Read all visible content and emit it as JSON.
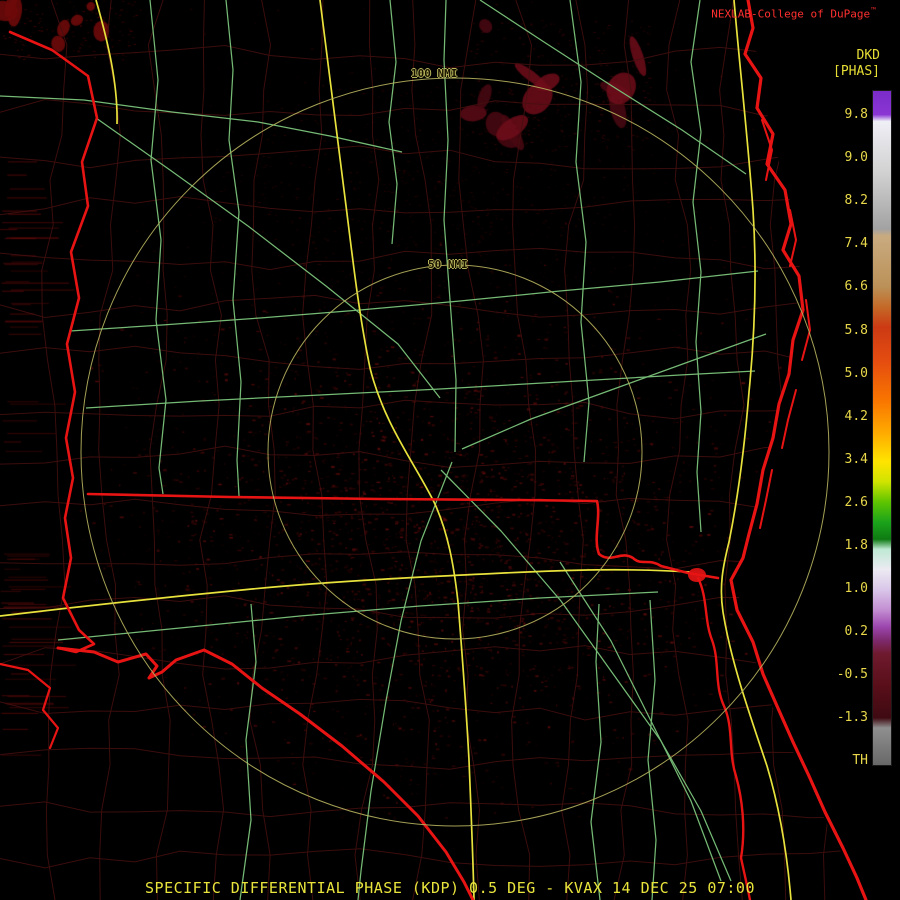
{
  "header": {
    "attribution": "NEXLAB-College of DuPage",
    "logo_mark": "™",
    "product_code": "DKD",
    "product_units": "[PHAS]"
  },
  "colorbar": {
    "ticks": [
      "9.8",
      "9.0",
      "8.2",
      "7.4",
      "6.6",
      "5.8",
      "5.0",
      "4.2",
      "3.4",
      "2.6",
      "1.8",
      "1.0",
      "0.2",
      "-0.5",
      "-1.3"
    ],
    "threshold_label": "TH",
    "gradient_stops": [
      {
        "p": 0,
        "c": "#7a2cc8"
      },
      {
        "p": 3.5,
        "c": "#8a35d4"
      },
      {
        "p": 4.5,
        "c": "#efeff6"
      },
      {
        "p": 12,
        "c": "#d2d2d2"
      },
      {
        "p": 20.5,
        "c": "#a2a2a2"
      },
      {
        "p": 21.5,
        "c": "#c9ab80"
      },
      {
        "p": 29,
        "c": "#bb9158"
      },
      {
        "p": 32,
        "c": "#c46a28"
      },
      {
        "p": 35,
        "c": "#cc3a14"
      },
      {
        "p": 40,
        "c": "#e44c10"
      },
      {
        "p": 46,
        "c": "#f97600"
      },
      {
        "p": 51,
        "c": "#ffae00"
      },
      {
        "p": 55,
        "c": "#ffe400"
      },
      {
        "p": 58,
        "c": "#cfe400"
      },
      {
        "p": 61,
        "c": "#5ec400"
      },
      {
        "p": 64,
        "c": "#1ba31b"
      },
      {
        "p": 66.5,
        "c": "#0e7a12"
      },
      {
        "p": 68,
        "c": "#bfe9d4"
      },
      {
        "p": 71,
        "c": "#eceaf2"
      },
      {
        "p": 74,
        "c": "#d9c6e9"
      },
      {
        "p": 77,
        "c": "#c38ed2"
      },
      {
        "p": 79.5,
        "c": "#9c46ae"
      },
      {
        "p": 81.5,
        "c": "#7d2a6e"
      },
      {
        "p": 83.5,
        "c": "#6f1a2e"
      },
      {
        "p": 88,
        "c": "#5a0f1a"
      },
      {
        "p": 93,
        "c": "#3f0a12"
      },
      {
        "p": 94.5,
        "c": "#8f8f8f"
      },
      {
        "p": 100,
        "c": "#686868"
      }
    ]
  },
  "map": {
    "range_ring_labels": {
      "outer": "100 NMI",
      "inner": "50 NMI"
    },
    "colors": {
      "state_border": "#e81414",
      "interstate": "#e8e23c",
      "highway": "#7cc47c",
      "county": "#471010",
      "range_ring": "#b6b25e",
      "echo": "#5a0a0a"
    }
  },
  "status_bar": {
    "title": "SPECIFIC DIFFERENTIAL PHASE (KDP) 0.5 DEG - KVAX 14 DEC 25 07:00"
  }
}
